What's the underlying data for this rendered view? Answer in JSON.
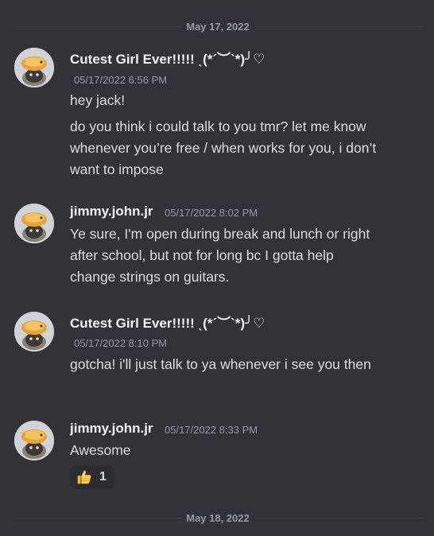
{
  "dividers": [
    "May 17, 2022",
    "May 18, 2022"
  ],
  "messages": [
    {
      "author": "Cutest Girl Ever!!!!! ˎ(*´︶`*)╯♡",
      "timestamp": "05/17/2022 6:56 PM",
      "lines": [
        "hey jack!",
        "do you think i could talk to you tmr? let me know whenever you’re free / when works for you, i don’t want to impose"
      ]
    },
    {
      "author": "jimmy.john.jr",
      "timestamp": "05/17/2022 8:02 PM",
      "lines": [
        "Ye sure, I'm open during break and lunch or right after school, but not for long bc I gotta help change strings on guitars."
      ]
    },
    {
      "author": "Cutest Girl Ever!!!!! ˎ(*´︶`*)╯♡",
      "timestamp": "05/17/2022 8:10 PM",
      "lines": [
        "gotcha! i'll just talk to ya whenever i see you then"
      ]
    },
    {
      "author": "jimmy.john.jr",
      "timestamp": "05/17/2022 8:33 PM",
      "lines": [
        "Awesome"
      ],
      "reaction": {
        "icon": "thumbs-up-icon",
        "count": "1"
      }
    }
  ],
  "colors": {
    "background": "#313338",
    "text": "#dbdee1",
    "muted": "#949ba4",
    "name": "#f2f3f5"
  }
}
